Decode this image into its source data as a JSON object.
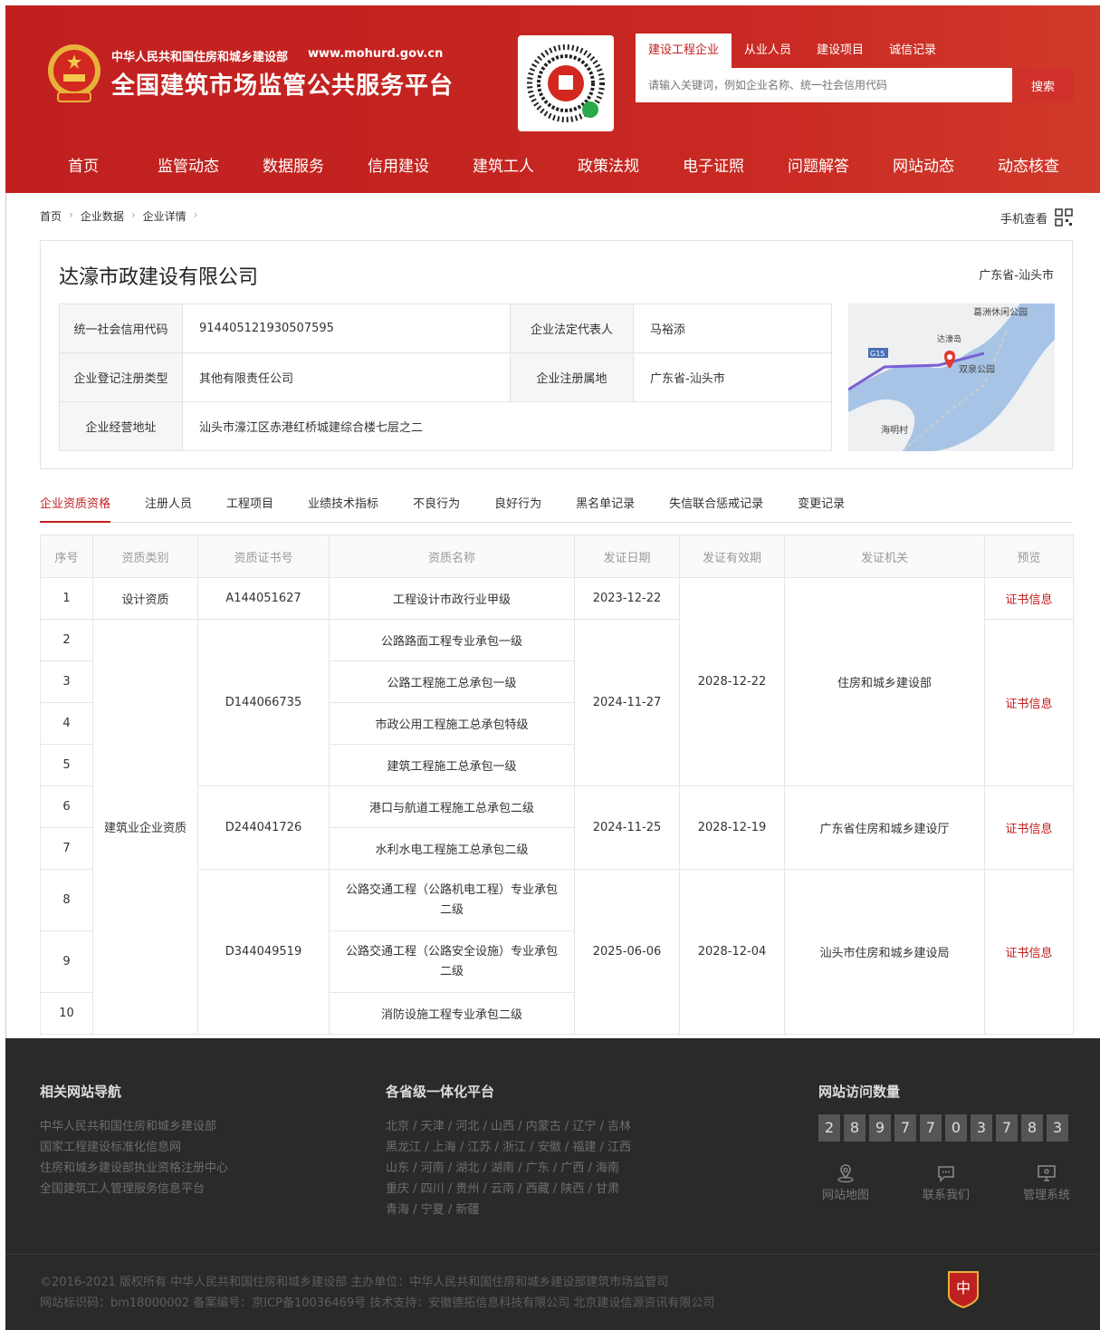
{
  "header": {
    "ministry": "中华人民共和国住房和城乡建设部",
    "url": "www.mohurd.gov.cn",
    "platform": "全国建筑市场监管公共服务平台",
    "search_tabs": [
      "建设工程企业",
      "从业人员",
      "建设项目",
      "诚信记录"
    ],
    "search_placeholder": "请输入关键词，例如企业名称、统一社会信用代码",
    "search_button": "搜索"
  },
  "nav": [
    "首页",
    "监管动态",
    "数据服务",
    "信用建设",
    "建筑工人",
    "政策法规",
    "电子证照",
    "问题解答",
    "网站动态",
    "动态核查"
  ],
  "breadcrumb": [
    "首页",
    "企业数据",
    "企业详情"
  ],
  "mobile_view": "手机查看",
  "company": {
    "name": "达濠市政建设有限公司",
    "region": "广东省-汕头市",
    "credit_code_label": "统一社会信用代码",
    "credit_code": "914405121930507595",
    "legal_rep_label": "企业法定代表人",
    "legal_rep": "马裕添",
    "reg_type_label": "企业登记注册类型",
    "reg_type": "其他有限责任公司",
    "reg_place_label": "企业注册属地",
    "reg_place": "广东省-汕头市",
    "address_label": "企业经营地址",
    "address": "汕头市濠江区赤港红桥城建综合楼七层之二"
  },
  "map": {
    "labels": [
      "葛洲休闲公园",
      "达濠岛",
      "G15",
      "双泉公园",
      "海明村"
    ]
  },
  "tabs": [
    "企业资质资格",
    "注册人员",
    "工程项目",
    "业绩技术指标",
    "不良行为",
    "良好行为",
    "黑名单记录",
    "失信联合惩戒记录",
    "变更记录"
  ],
  "table": {
    "headers": [
      "序号",
      "资质类别",
      "资质证书号",
      "资质名称",
      "发证日期",
      "发证有效期",
      "发证机关",
      "预览"
    ],
    "link_text": "证书信息",
    "categories": [
      "设计资质",
      "建筑业企业资质"
    ],
    "certs": [
      "A144051627",
      "D144066735",
      "D244041726",
      "D344049519"
    ],
    "names": [
      "工程设计市政行业甲级",
      "公路路面工程专业承包一级",
      "公路工程施工总承包一级",
      "市政公用工程施工总承包特级",
      "建筑工程施工总承包一级",
      "港口与航道工程施工总承包二级",
      "水利水电工程施工总承包二级",
      "公路交通工程（公路机电工程）专业承包二级",
      "公路交通工程（公路安全设施）专业承包二级",
      "消防设施工程专业承包二级"
    ],
    "issue_dates": [
      "2023-12-22",
      "2024-11-27",
      "2024-11-25",
      "2025-06-06"
    ],
    "valid_dates": [
      "2028-12-22",
      "2028-12-19",
      "2028-12-04"
    ],
    "authorities": [
      "住房和城乡建设部",
      "广东省住房和城乡建设厅",
      "汕头市住房和城乡建设局"
    ]
  },
  "footer": {
    "nav_title": "相关网站导航",
    "nav_links": [
      "中华人民共和国住房和城乡建设部",
      "国家工程建设标准化信息网",
      "住房和城乡建设部执业资格注册中心",
      "全国建筑工人管理服务信息平台"
    ],
    "prov_title": "各省级一体化平台",
    "provinces": [
      "北京",
      "天津",
      "河北",
      "山西",
      "内蒙古",
      "辽宁",
      "吉林",
      "黑龙江",
      "上海",
      "江苏",
      "浙江",
      "安徽",
      "福建",
      "江西",
      "山东",
      "河南",
      "湖北",
      "湖南",
      "广东",
      "广西",
      "海南",
      "重庆",
      "四川",
      "贵州",
      "云南",
      "西藏",
      "陕西",
      "甘肃",
      "青海",
      "宁夏",
      "新疆"
    ],
    "visits_title": "网站访问数量",
    "visit_digits": [
      "2",
      "8",
      "9",
      "7",
      "7",
      "0",
      "3",
      "7",
      "8",
      "3"
    ],
    "icons": [
      {
        "label": "网站地图",
        "icon": "map-pin-icon"
      },
      {
        "label": "联系我们",
        "icon": "chat-icon"
      },
      {
        "label": "管理系统",
        "icon": "monitor-icon"
      }
    ],
    "copyright": "©2016-2021 版权所有 中华人民共和国住房和城乡建设部   主办单位：中华人民共和国住房和城乡建设部建筑市场监管司",
    "icp": "网站标识码：bm18000002   备案编号：京ICP备10036469号   技术支持：安徽德拓信息科技有限公司 北京建设信源资讯有限公司"
  }
}
